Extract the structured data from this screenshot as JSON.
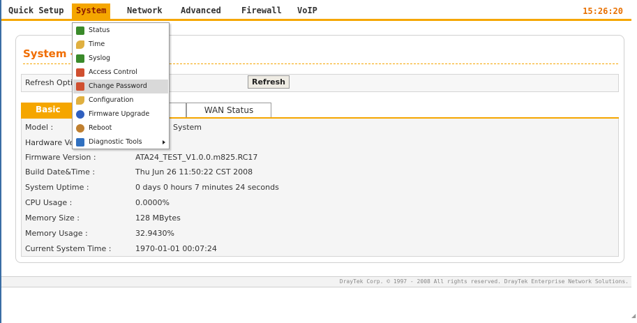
{
  "topbar": {
    "items": [
      "Quick Setup",
      "System",
      "Network",
      "Advanced",
      "Firewall",
      "VoIP"
    ],
    "active": "System",
    "clock": "15:26:20"
  },
  "dropdown": {
    "items": [
      {
        "label": "Status",
        "icon": "status-icon",
        "color": "#3a8a2a"
      },
      {
        "label": "Time",
        "icon": "wrench-icon",
        "color": "#e0b040"
      },
      {
        "label": "Syslog",
        "icon": "syslog-icon",
        "color": "#3a8a2a"
      },
      {
        "label": "Access Control",
        "icon": "users-icon",
        "color": "#d05030"
      },
      {
        "label": "Change Password",
        "icon": "users-icon",
        "color": "#d05030"
      },
      {
        "label": "Configuration",
        "icon": "wrench-icon",
        "color": "#e0b040"
      },
      {
        "label": "Firmware Upgrade",
        "icon": "globe-icon",
        "color": "#3060c0"
      },
      {
        "label": "Reboot",
        "icon": "reboot-icon",
        "color": "#c08030"
      },
      {
        "label": "Diagnostic Tools",
        "icon": "tools-list-icon",
        "color": "#3070c0"
      }
    ],
    "hovered": "Change Password"
  },
  "page": {
    "title": "System -",
    "refresh_label": "Refresh Optio",
    "refresh_button": "Refresh",
    "tabs": {
      "basic": "Basic St",
      "wan": "WAN Status"
    }
  },
  "info": [
    {
      "label": "Model :",
      "value": "System"
    },
    {
      "label": "Hardware Ver",
      "value": ""
    },
    {
      "label": "Firmware Version :",
      "value": "ATA24_TEST_V1.0.0.m825.RC17"
    },
    {
      "label": "Build Date&Time :",
      "value": "Thu Jun 26 11:50:22 CST 2008"
    },
    {
      "label": "System Uptime :",
      "value": "0 days 0 hours 7 minutes 24 seconds"
    },
    {
      "label": "CPU Usage :",
      "value": "0.0000%"
    },
    {
      "label": "Memory Size :",
      "value": "128 MBytes"
    },
    {
      "label": "Memory Usage :",
      "value": "32.9430%"
    },
    {
      "label": "Current System Time :",
      "value": "1970-01-01 00:07:24"
    }
  ],
  "footer": {
    "text": "DrayTek Corp. © 1997 - 2008 All rights reserved. DrayTek Enterprise Network Solutions."
  },
  "colors": {
    "accent": "#f5a600",
    "title": "#f06d00",
    "clock": "#e87000"
  }
}
